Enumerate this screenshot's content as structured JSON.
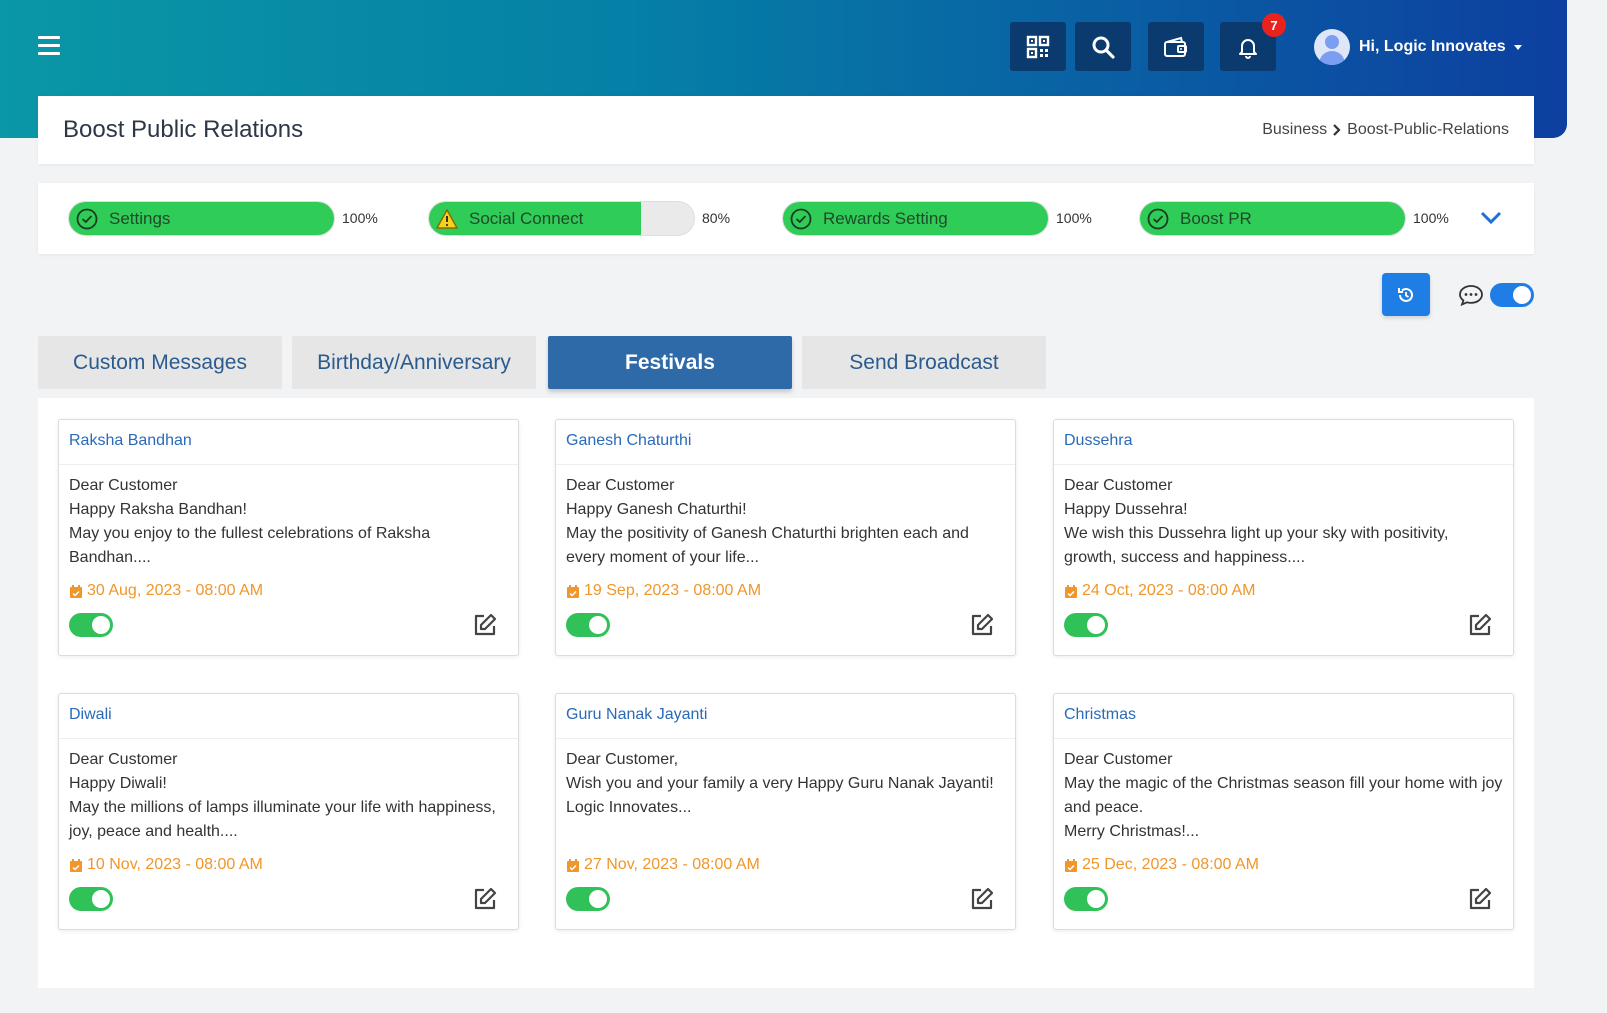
{
  "header": {
    "user_greeting": "Hi, Logic Innovates",
    "notification_count": "7"
  },
  "page": {
    "title": "Boost Public Relations",
    "breadcrumb": {
      "parent": "Business",
      "current": "Boost-Public-Relations"
    }
  },
  "progress": [
    {
      "label": "Settings",
      "percent_text": "100%",
      "value": 100,
      "status": "complete"
    },
    {
      "label": "Social Connect",
      "percent_text": "80%",
      "value": 80,
      "status": "warning"
    },
    {
      "label": "Rewards Setting",
      "percent_text": "100%",
      "value": 100,
      "status": "complete"
    },
    {
      "label": "Boost PR",
      "percent_text": "100%",
      "value": 100,
      "status": "complete"
    }
  ],
  "tabs": [
    {
      "label": "Custom Messages",
      "active": false
    },
    {
      "label": "Birthday/Anniversary",
      "active": false
    },
    {
      "label": "Festivals",
      "active": true
    },
    {
      "label": "Send Broadcast",
      "active": false
    }
  ],
  "festivals": [
    {
      "title": "Raksha Bandhan",
      "lines": [
        "Dear Customer",
        "Happy Raksha Bandhan!",
        "May you enjoy to the fullest celebrations of Raksha Bandhan...."
      ],
      "date": "30 Aug, 2023 - 08:00 AM",
      "enabled": true
    },
    {
      "title": "Ganesh Chaturthi",
      "lines": [
        "Dear Customer",
        "Happy Ganesh Chaturthi!",
        "May the positivity of Ganesh Chaturthi brighten each and every moment of your life..."
      ],
      "date": "19 Sep, 2023 - 08:00 AM",
      "enabled": true
    },
    {
      "title": "Dussehra",
      "lines": [
        "Dear Customer",
        "Happy Dussehra!",
        "We wish this Dussehra light up your sky with positivity, growth, success and happiness...."
      ],
      "date": "24 Oct, 2023 - 08:00 AM",
      "enabled": true
    },
    {
      "title": "Diwali",
      "lines": [
        "Dear Customer",
        "Happy Diwali!",
        "May the millions of lamps illuminate your life with happiness, joy, peace and health...."
      ],
      "date": "10 Nov, 2023 - 08:00 AM",
      "enabled": true
    },
    {
      "title": "Guru Nanak Jayanti",
      "lines": [
        "Dear Customer,",
        "Wish you and your family a very Happy Guru Nanak Jayanti!",
        "Logic Innovates..."
      ],
      "date": "27 Nov, 2023 - 08:00 AM",
      "enabled": true
    },
    {
      "title": "Christmas",
      "lines": [
        "Dear Customer",
        "May the magic of the Christmas season fill your home with joy and peace.",
        "Merry Christmas!..."
      ],
      "date": "25 Dec, 2023 - 08:00 AM",
      "enabled": true
    }
  ],
  "colors": {
    "accent": "#2f6aa8",
    "progress_green": "#30cc58",
    "date_orange": "#f0962a",
    "title_blue": "#2a6ab8"
  }
}
